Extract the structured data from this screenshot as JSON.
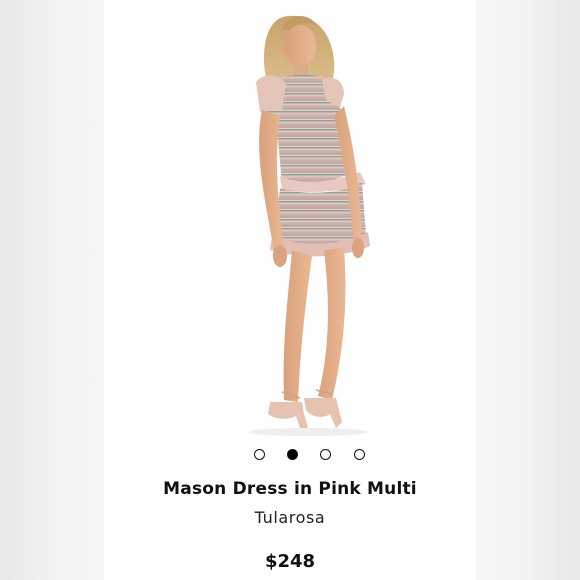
{
  "product": {
    "title": "Mason Dress in Pink Multi",
    "brand": "Tularosa",
    "price": "$248"
  },
  "carousel": {
    "total_images": 4,
    "active_index": 1
  },
  "colors": {
    "dress_pink": "#e8c7bd",
    "accent_teal": "#6f9e9a",
    "page_background": "#f4f4f4",
    "text": "#111111"
  }
}
